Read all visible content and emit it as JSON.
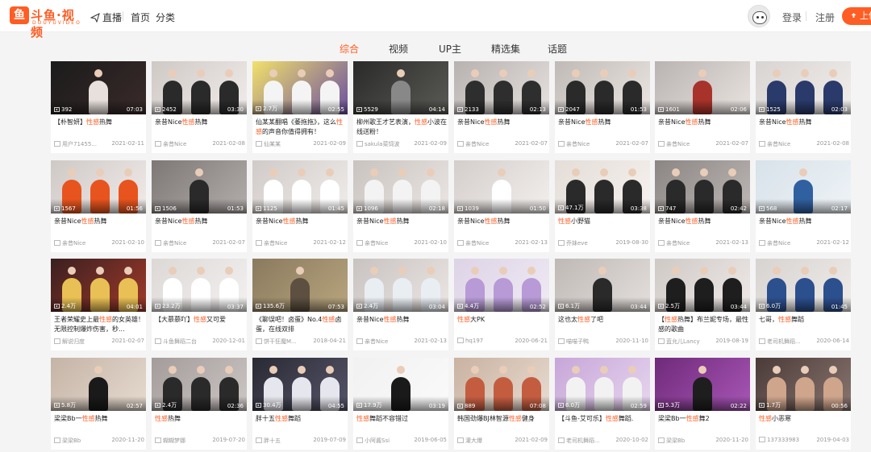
{
  "header": {
    "logo_text": "斗鱼·视频",
    "logo_sub": "DOUYUVIDEO",
    "nav": [
      "直播",
      "首页",
      "分类"
    ],
    "login": "登录",
    "register": "注册",
    "upload": "上传"
  },
  "tabs": [
    "综合",
    "视频",
    "UP主",
    "精选集",
    "话题"
  ],
  "colors": {
    "accent": "#ff5d23",
    "bg": "#f4f4f4"
  },
  "videos": [
    {
      "views": "392",
      "duration": "07:03",
      "title": [
        "【朴智妍】",
        "性感",
        "热舞"
      ],
      "author": "用户71455...",
      "date": "2021-02-11"
    },
    {
      "views": "2452",
      "duration": "03:30",
      "title": [
        "亲昔Nice",
        "性感",
        "热舞"
      ],
      "author": "亲昔Nice",
      "date": "2021-02-08"
    },
    {
      "views": "2.7万",
      "duration": "02:55",
      "title": [
        "仙某某翻唱《萎拖拖》，这么",
        "性感",
        "的声音你值得拥有！"
      ],
      "author": "仙某某",
      "date": "2021-02-09"
    },
    {
      "views": "5529",
      "duration": "04:14",
      "title": [
        "柳州歌王才艺表演，",
        "性感",
        "小波在线送粉！"
      ],
      "author": "sakula菜饲波",
      "date": "2021-02-09"
    },
    {
      "views": "2133",
      "duration": "02:13",
      "title": [
        "亲昔Nice",
        "性感",
        "热舞"
      ],
      "author": "亲昔Nice",
      "date": "2021-02-07"
    },
    {
      "views": "2047",
      "duration": "01:53",
      "title": [
        "亲昔Nice",
        "性感",
        "热舞"
      ],
      "author": "亲昔Nice",
      "date": "2021-02-07"
    },
    {
      "views": "1601",
      "duration": "02:06",
      "title": [
        "亲昔Nice",
        "性感",
        "热舞"
      ],
      "author": "亲昔Nice",
      "date": "2021-02-07"
    },
    {
      "views": "1525",
      "duration": "02:03",
      "title": [
        "亲昔Nice",
        "性感",
        "热舞"
      ],
      "author": "亲昔Nice",
      "date": "2021-02-08"
    },
    {
      "views": "1567",
      "duration": "01:56",
      "title": [
        "亲昔Nice",
        "性感",
        "热舞"
      ],
      "author": "亲昔Nice",
      "date": "2021-02-10"
    },
    {
      "views": "1506",
      "duration": "01:53",
      "title": [
        "亲昔Nice",
        "性感",
        "热舞"
      ],
      "author": "亲昔Nice",
      "date": "2021-02-07"
    },
    {
      "views": "1125",
      "duration": "01:45",
      "title": [
        "亲昔Nice",
        "性感",
        "热舞"
      ],
      "author": "亲昔Nice",
      "date": "2021-02-12"
    },
    {
      "views": "1096",
      "duration": "02:18",
      "title": [
        "亲昔Nice",
        "性感",
        "热舞"
      ],
      "author": "亲昔Nice",
      "date": "2021-02-10"
    },
    {
      "views": "1039",
      "duration": "01:50",
      "title": [
        "亲昔Nice",
        "性感",
        "热舞"
      ],
      "author": "亲昔Nice",
      "date": "2021-02-13"
    },
    {
      "views": "47.1万",
      "duration": "03:38",
      "title": [
        "",
        "性感",
        "小野猫"
      ],
      "author": "乔妹eve",
      "date": "2019-08-30"
    },
    {
      "views": "747",
      "duration": "02:42",
      "title": [
        "亲昔Nice",
        "性感",
        "热舞"
      ],
      "author": "亲昔Nice",
      "date": "2021-02-13"
    },
    {
      "views": "568",
      "duration": "02:17",
      "title": [
        "亲昔Nice",
        "性感",
        "热舞"
      ],
      "author": "亲昔Nice",
      "date": "2021-02-12"
    },
    {
      "views": "2.4万",
      "duration": "04:01",
      "title": [
        "王者荣耀史上最",
        "性感",
        "的女英雄！无限控制爆炸伤害，秒..."
      ],
      "author": "解说归度",
      "date": "2021-02-07"
    },
    {
      "views": "23.2万",
      "duration": "03:37",
      "title": [
        "【大慕慕吖】",
        "性感",
        "又可爱"
      ],
      "author": "斗鱼舞蹈二台",
      "date": "2020-12-01"
    },
    {
      "views": "135.6万",
      "duration": "07:53",
      "title": [
        "《聊误吧！卤蛋》No.4",
        "性感",
        "卤蛋，在线双排"
      ],
      "author": "饼干狂魔M...",
      "date": "2018-04-21"
    },
    {
      "views": "2.4万",
      "duration": "03:04",
      "title": [
        "亲昔Nice",
        "性感",
        "热舞"
      ],
      "author": "亲昔Nice",
      "date": "2021-02-13"
    },
    {
      "views": "4.4万",
      "duration": "02:52",
      "title": [
        "",
        "性感",
        "大PK"
      ],
      "author": "hq197",
      "date": "2020-06-21"
    },
    {
      "views": "6.1万",
      "duration": "03:44",
      "title": [
        "这也太",
        "性感",
        "了吧"
      ],
      "author": "喵喵子鸭",
      "date": "2020-11-10"
    },
    {
      "views": "2.5万",
      "duration": "03:44",
      "title": [
        "【",
        "性感",
        "热舞】布兰妮专场，最性感的歌曲"
      ],
      "author": "蓝允儿Lancy",
      "date": "2019-08-19"
    },
    {
      "views": "6.0万",
      "duration": "01:45",
      "title": [
        "七哥，",
        "性感",
        "舞蹈"
      ],
      "author": "老司机舞蹈...",
      "date": "2020-06-14"
    },
    {
      "views": "5.8万",
      "duration": "02:57",
      "title": [
        "梁梁Bb一",
        "性感",
        "热舞"
      ],
      "author": "梁梁Bb",
      "date": "2020-11-20"
    },
    {
      "views": "2.4万",
      "duration": "02:36",
      "title": [
        "",
        "性感",
        "热舞"
      ],
      "author": "糊糊梦娜",
      "date": "2019-07-20"
    },
    {
      "views": "30.4万",
      "duration": "04:55",
      "title": [
        "胖十五",
        "性感",
        "舞蹈"
      ],
      "author": "胖十五",
      "date": "2019-07-09"
    },
    {
      "views": "17.9万",
      "duration": "03:19",
      "title": [
        "",
        "性感",
        "舞蹈不容错过"
      ],
      "author": "小阿酱Ssi",
      "date": "2019-06-05"
    },
    {
      "views": "889",
      "duration": "07:08",
      "title": [
        "韩国劲爆BJ林智源",
        "性感",
        "健身"
      ],
      "author": "灌大爆",
      "date": "2021-02-09"
    },
    {
      "views": "6.0万",
      "duration": "02:59",
      "title": [
        "【斗鱼-艾可乐】",
        "性感",
        "舞蹈."
      ],
      "author": "老司机舞蹈...",
      "date": "2020-10-02"
    },
    {
      "views": "5.3万",
      "duration": "02:22",
      "title": [
        "梁梁Bb一",
        "性感",
        "舞2"
      ],
      "author": "梁梁Bb",
      "date": "2020-11-20"
    },
    {
      "views": "1.7万",
      "duration": "00:56",
      "title": [
        "",
        "性感",
        "小恶寒"
      ],
      "author": "137333983",
      "date": "2019-04-03"
    }
  ]
}
